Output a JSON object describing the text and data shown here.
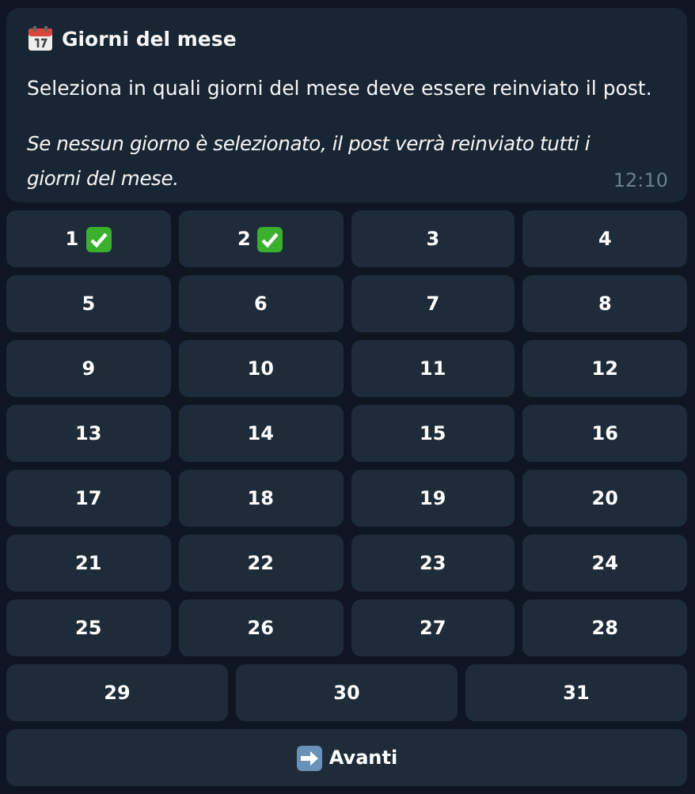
{
  "message": {
    "title": "Giorni del mese",
    "text": "Seleziona in quali giorni del mese deve essere reinviato il post.",
    "note": "Se nessun giorno è selezionato, il post verrà reinviato tutti i giorni del mese.",
    "time": "12:10"
  },
  "keyboard": [
    [
      {
        "label": "1",
        "selected": true
      },
      {
        "label": "2",
        "selected": true
      },
      {
        "label": "3",
        "selected": false
      },
      {
        "label": "4",
        "selected": false
      }
    ],
    [
      {
        "label": "5",
        "selected": false
      },
      {
        "label": "6",
        "selected": false
      },
      {
        "label": "7",
        "selected": false
      },
      {
        "label": "8",
        "selected": false
      }
    ],
    [
      {
        "label": "9",
        "selected": false
      },
      {
        "label": "10",
        "selected": false
      },
      {
        "label": "11",
        "selected": false
      },
      {
        "label": "12",
        "selected": false
      }
    ],
    [
      {
        "label": "13",
        "selected": false
      },
      {
        "label": "14",
        "selected": false
      },
      {
        "label": "15",
        "selected": false
      },
      {
        "label": "16",
        "selected": false
      }
    ],
    [
      {
        "label": "17",
        "selected": false
      },
      {
        "label": "18",
        "selected": false
      },
      {
        "label": "19",
        "selected": false
      },
      {
        "label": "20",
        "selected": false
      }
    ],
    [
      {
        "label": "21",
        "selected": false
      },
      {
        "label": "22",
        "selected": false
      },
      {
        "label": "23",
        "selected": false
      },
      {
        "label": "24",
        "selected": false
      }
    ],
    [
      {
        "label": "25",
        "selected": false
      },
      {
        "label": "26",
        "selected": false
      },
      {
        "label": "27",
        "selected": false
      },
      {
        "label": "28",
        "selected": false
      }
    ],
    [
      {
        "label": "29",
        "selected": false
      },
      {
        "label": "30",
        "selected": false
      },
      {
        "label": "31",
        "selected": false
      }
    ]
  ],
  "next_button": {
    "label": "Avanti"
  }
}
